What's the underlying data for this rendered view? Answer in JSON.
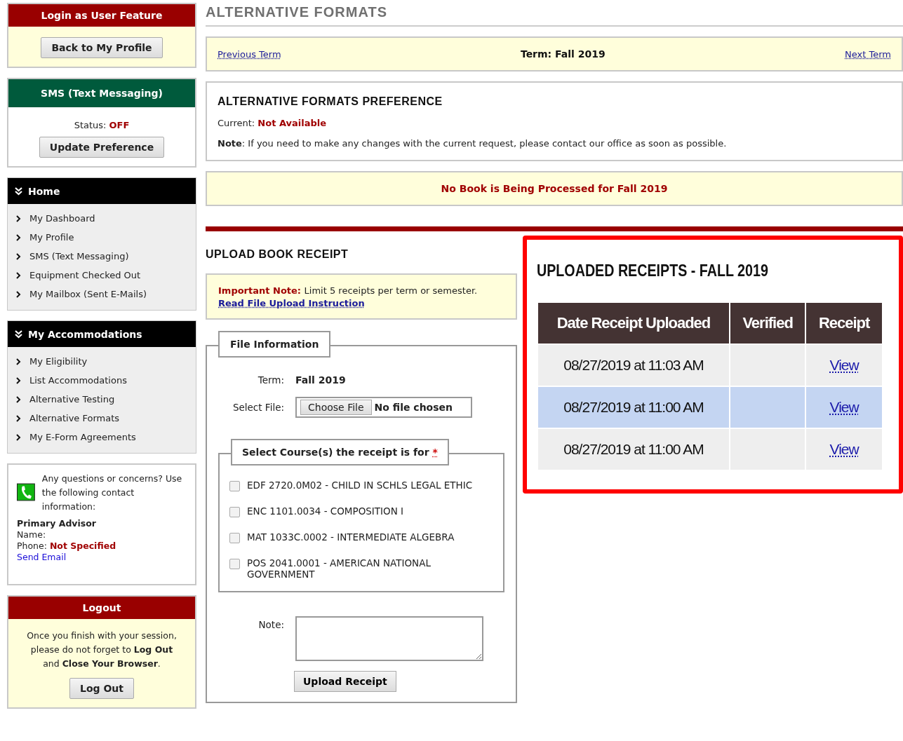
{
  "login_panel": {
    "title": "Login as User Feature",
    "button": "Back to My Profile"
  },
  "sms_panel": {
    "title": "SMS (Text Messaging)",
    "status_label": "Status:",
    "status_value": "OFF",
    "button": "Update Preference"
  },
  "menus": [
    {
      "title": "Home",
      "expanded": true,
      "items": [
        "My Dashboard",
        "My Profile",
        "SMS (Text Messaging)",
        "Equipment Checked Out",
        "My Mailbox (Sent E-Mails)"
      ]
    },
    {
      "title": "My Accommodations",
      "expanded": true,
      "items": [
        "My Eligibility",
        "List Accommodations",
        "Alternative Testing",
        "Alternative Formats",
        "My E-Form Agreements"
      ]
    }
  ],
  "contact": {
    "intro": "Any questions or concerns? Use the following contact information:",
    "advisor_heading": "Primary Advisor",
    "name_label": "Name:",
    "phone_label": "Phone:",
    "phone_value": "Not Specified",
    "email_link": "Send Email"
  },
  "logout": {
    "title": "Logout",
    "message": "Once you finish with your session, please do not forget to **Log Out** and **Close Your Browser**.",
    "button": "Log Out"
  },
  "page_title": "ALTERNATIVE FORMATS",
  "term_nav": {
    "previous": "Previous Term",
    "current": "Term: Fall 2019",
    "next": "Next Term"
  },
  "preference": {
    "heading": "ALTERNATIVE FORMATS PREFERENCE",
    "current_label": "Current:",
    "current_value": "Not Available",
    "note": "**Note**: If you need to make any changes with the current request, please contact our office as soon as possible."
  },
  "processing_notice": "No Book is Being Processed for Fall 2019",
  "upload": {
    "heading": "UPLOAD BOOK RECEIPT",
    "important_label": "Important Note:",
    "important_text": "Limit 5 receipts per term or semester.",
    "instruction_link": "Read File Upload Instruction",
    "legend": "File Information",
    "term_label": "Term:",
    "term_value": "Fall 2019",
    "file_label": "Select File:",
    "file_button": "Choose File",
    "file_status": "No file chosen",
    "courses_legend": "Select Course(s) the receipt is for",
    "required_mark": "*",
    "courses": [
      {
        "label": "EDF 2720.0M02 - CHILD IN SCHLS LEGAL ETHIC",
        "checked": false
      },
      {
        "label": "ENC 1101.0034 - COMPOSITION I",
        "checked": false
      },
      {
        "label": "MAT 1033C.0002 - INTERMEDIATE ALGEBRA",
        "checked": false
      },
      {
        "label": "POS 2041.0001 - AMERICAN NATIONAL GOVERNMENT",
        "checked": false
      }
    ],
    "note_label": "Note:",
    "submit": "Upload Receipt"
  },
  "receipts": {
    "heading": "UPLOADED RECEIPTS - FALL 2019",
    "highlighted": true,
    "columns": [
      "Date Receipt Uploaded",
      "Verified",
      "Receipt"
    ],
    "rows": [
      {
        "date": "08/27/2019 at 11:03 AM",
        "link": "View",
        "selected": false
      },
      {
        "date": "08/27/2019 at 11:00 AM",
        "link": "View",
        "selected": true
      },
      {
        "date": "08/27/2019 at 11:00 AM",
        "link": "View",
        "selected": false
      }
    ]
  }
}
